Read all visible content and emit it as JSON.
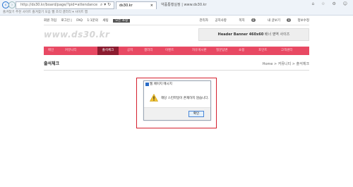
{
  "browser": {
    "address": "http://ds30.kr/board/page/?pid=attendance",
    "active_tab": "ds30.kr",
    "inactive_tab": "약품통행실정 | www.ds30.kr",
    "favorites": "즐겨찾기  추천 사이트  즐겨찾기 모음  웹 조각 갤러리  ▾  사이트 맵"
  },
  "site": {
    "topbar_left": [
      "회원 가입",
      "로그인 |",
      "FAQ",
      "1:1문의",
      "세팅"
    ],
    "topbar_left_dark": "모든 쇼핑",
    "topbar_right": [
      "관리자",
      "공지사항",
      "쪽지",
      "내 글보기",
      "정보수정"
    ],
    "badges": [
      "0",
      "0"
    ],
    "logo": "www.ds30.kr",
    "banner_bold": "Header Banner 460x60",
    "banner_rest": " 배너 영역 사이즈",
    "menu_items": [
      "메인",
      "커뮤니티",
      "출석체크",
      "공지",
      "갤러리",
      "이벤트",
      "자유게시판",
      "질문답변",
      "쇼핑",
      "포인트",
      "고객센터"
    ],
    "page_title": "출석체크",
    "breadcrumb": "Home  >  커뮤니티  >  출석체크"
  },
  "dialog": {
    "title": "웹 페이지 메시지",
    "message": "해당 스킨파일이 존재하지 않습니다.",
    "ok_label": "확인"
  }
}
